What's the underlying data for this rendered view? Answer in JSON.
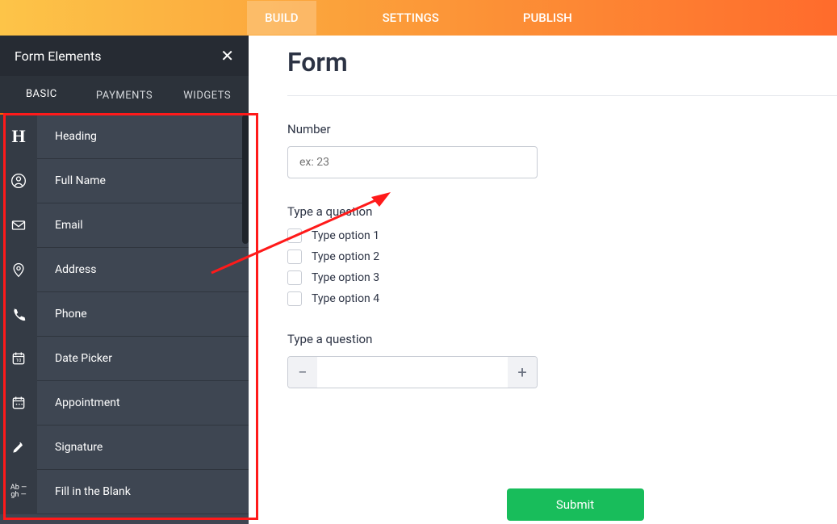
{
  "topnav": {
    "tabs": [
      "BUILD",
      "SETTINGS",
      "PUBLISH"
    ],
    "active": 0
  },
  "sidebar": {
    "title": "Form Elements",
    "tabs": [
      "BASIC",
      "PAYMENTS",
      "WIDGETS"
    ],
    "active_tab": 0,
    "items": [
      {
        "icon": "heading",
        "label": "Heading"
      },
      {
        "icon": "user",
        "label": "Full Name"
      },
      {
        "icon": "mail",
        "label": "Email"
      },
      {
        "icon": "pin",
        "label": "Address"
      },
      {
        "icon": "phone",
        "label": "Phone"
      },
      {
        "icon": "cal",
        "label": "Date Picker"
      },
      {
        "icon": "appt",
        "label": "Appointment"
      },
      {
        "icon": "sig",
        "label": "Signature"
      },
      {
        "icon": "blank",
        "label": "Fill in the Blank"
      }
    ]
  },
  "form": {
    "title": "Form",
    "number_field": {
      "label": "Number",
      "placeholder": "ex: 23"
    },
    "checkbox_q": {
      "label": "Type a question",
      "options": [
        "Type option 1",
        "Type option 2",
        "Type option 3",
        "Type option 4"
      ]
    },
    "spinner_q": {
      "label": "Type a question",
      "minus": "−",
      "plus": "+"
    },
    "submit_label": "Submit"
  },
  "colors": {
    "accent": "#ff6100",
    "submit": "#18bd5b",
    "annot": "#ff1a1a"
  }
}
